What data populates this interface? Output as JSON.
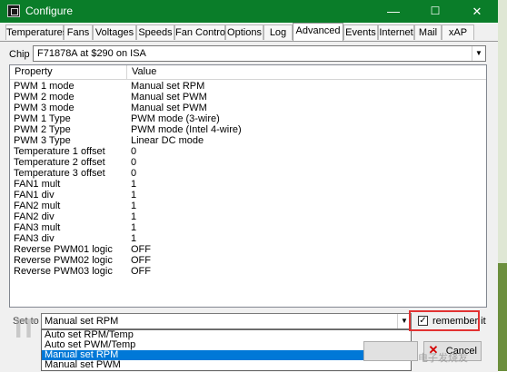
{
  "window": {
    "title": "Configure",
    "controls": {
      "minimize": "—",
      "maximize": "☐",
      "close": "✕"
    }
  },
  "tabs": [
    {
      "label": "Temperatures",
      "active": false
    },
    {
      "label": "Fans",
      "active": false
    },
    {
      "label": "Voltages",
      "active": false
    },
    {
      "label": "Speeds",
      "active": false
    },
    {
      "label": "Fan Control",
      "active": false
    },
    {
      "label": "Options",
      "active": false
    },
    {
      "label": "Log",
      "active": false
    },
    {
      "label": "Advanced",
      "active": true
    },
    {
      "label": "Events",
      "active": false
    },
    {
      "label": "Internet",
      "active": false
    },
    {
      "label": "Mail",
      "active": false
    },
    {
      "label": "xAP",
      "active": false
    }
  ],
  "chip": {
    "label": "Chip",
    "value": "F71878A at $290 on ISA"
  },
  "grid": {
    "columns": [
      "Property",
      "Value"
    ],
    "rows": [
      {
        "property": "PWM 1 mode",
        "value": "Manual set RPM"
      },
      {
        "property": "PWM 2 mode",
        "value": "Manual set PWM"
      },
      {
        "property": "PWM 3 mode",
        "value": "Manual set PWM"
      },
      {
        "property": "PWM 1 Type",
        "value": "PWM mode (3-wire)"
      },
      {
        "property": "PWM 2 Type",
        "value": "PWM mode (Intel 4-wire)"
      },
      {
        "property": "PWM 3 Type",
        "value": "Linear DC mode"
      },
      {
        "property": "Temperature 1 offset",
        "value": "0"
      },
      {
        "property": "Temperature 2 offset",
        "value": "0"
      },
      {
        "property": "Temperature 3 offset",
        "value": "0"
      },
      {
        "property": "FAN1 mult",
        "value": "1"
      },
      {
        "property": "FAN1 div",
        "value": "1"
      },
      {
        "property": "FAN2 mult",
        "value": "1"
      },
      {
        "property": "FAN2 div",
        "value": "1"
      },
      {
        "property": "FAN3 mult",
        "value": "1"
      },
      {
        "property": "FAN3 div",
        "value": "1"
      },
      {
        "property": "Reverse PWM01 logic",
        "value": "OFF"
      },
      {
        "property": "Reverse PWM02 logic",
        "value": "OFF"
      },
      {
        "property": "Reverse PWM03 logic",
        "value": "OFF"
      }
    ]
  },
  "set_to": {
    "label": "Set to",
    "value": "Manual set RPM",
    "options": [
      {
        "label": "Auto set RPM/Temp",
        "selected": false
      },
      {
        "label": "Auto set PWM/Temp",
        "selected": false
      },
      {
        "label": "Manual set RPM",
        "selected": true
      },
      {
        "label": "Manual set PWM",
        "selected": false
      }
    ]
  },
  "remember": {
    "label": "remember it",
    "checked": true,
    "checkmark": "✓"
  },
  "cancel": {
    "label": "Cancel",
    "icon": "✕"
  },
  "watermarks": {
    "left": "IT",
    "right": "电子发烧友"
  },
  "colors": {
    "titlebar": "#0a7d29",
    "highlight": "#e23232",
    "selection": "#0078d7"
  }
}
